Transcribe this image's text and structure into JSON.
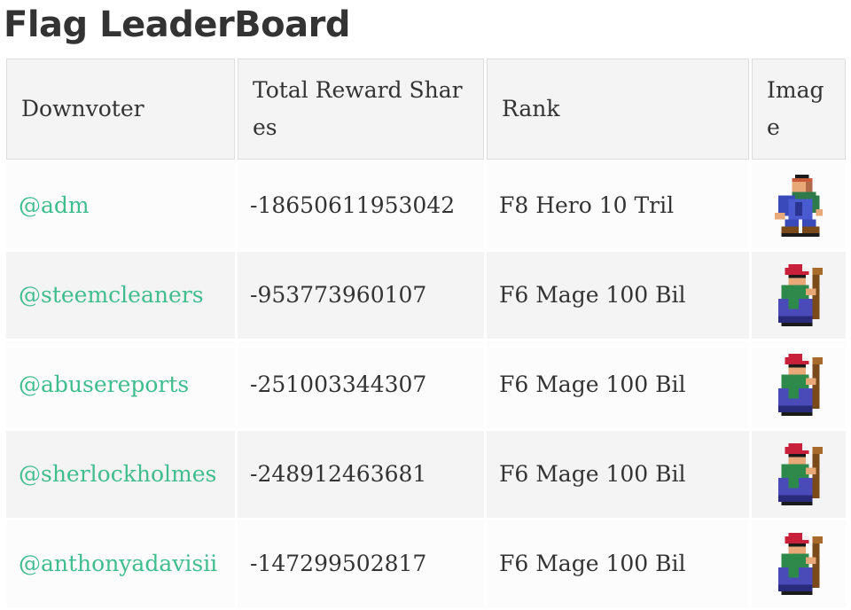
{
  "title": "Flag LeaderBoard",
  "columns": {
    "downvoter": "Downvoter",
    "reward_shares": "Total Reward Shares",
    "rank": "Rank",
    "image": "Image"
  },
  "rows": [
    {
      "user": "@adm",
      "shares": "-18650611953042",
      "rank": "F8 Hero 10 Tril",
      "icon": "hero-sprite-icon"
    },
    {
      "user": "@steemcleaners",
      "shares": "-953773960107",
      "rank": "F6 Mage 100 Bil",
      "icon": "mage-sprite-icon"
    },
    {
      "user": "@abusereports",
      "shares": "-251003344307",
      "rank": "F6 Mage 100 Bil",
      "icon": "mage-sprite-icon"
    },
    {
      "user": "@sherlockholmes",
      "shares": "-248912463681",
      "rank": "F6 Mage 100 Bil",
      "icon": "mage-sprite-icon"
    },
    {
      "user": "@anthonyadavisii",
      "shares": "-147299502817",
      "rank": "F6 Mage 100 Bil",
      "icon": "mage-sprite-icon"
    }
  ],
  "colors": {
    "link": "#3fbd8f",
    "text": "#333333",
    "header_bg": "#f4f4f4",
    "row_odd": "#fcfcfc",
    "row_even": "#f4f4f4"
  }
}
